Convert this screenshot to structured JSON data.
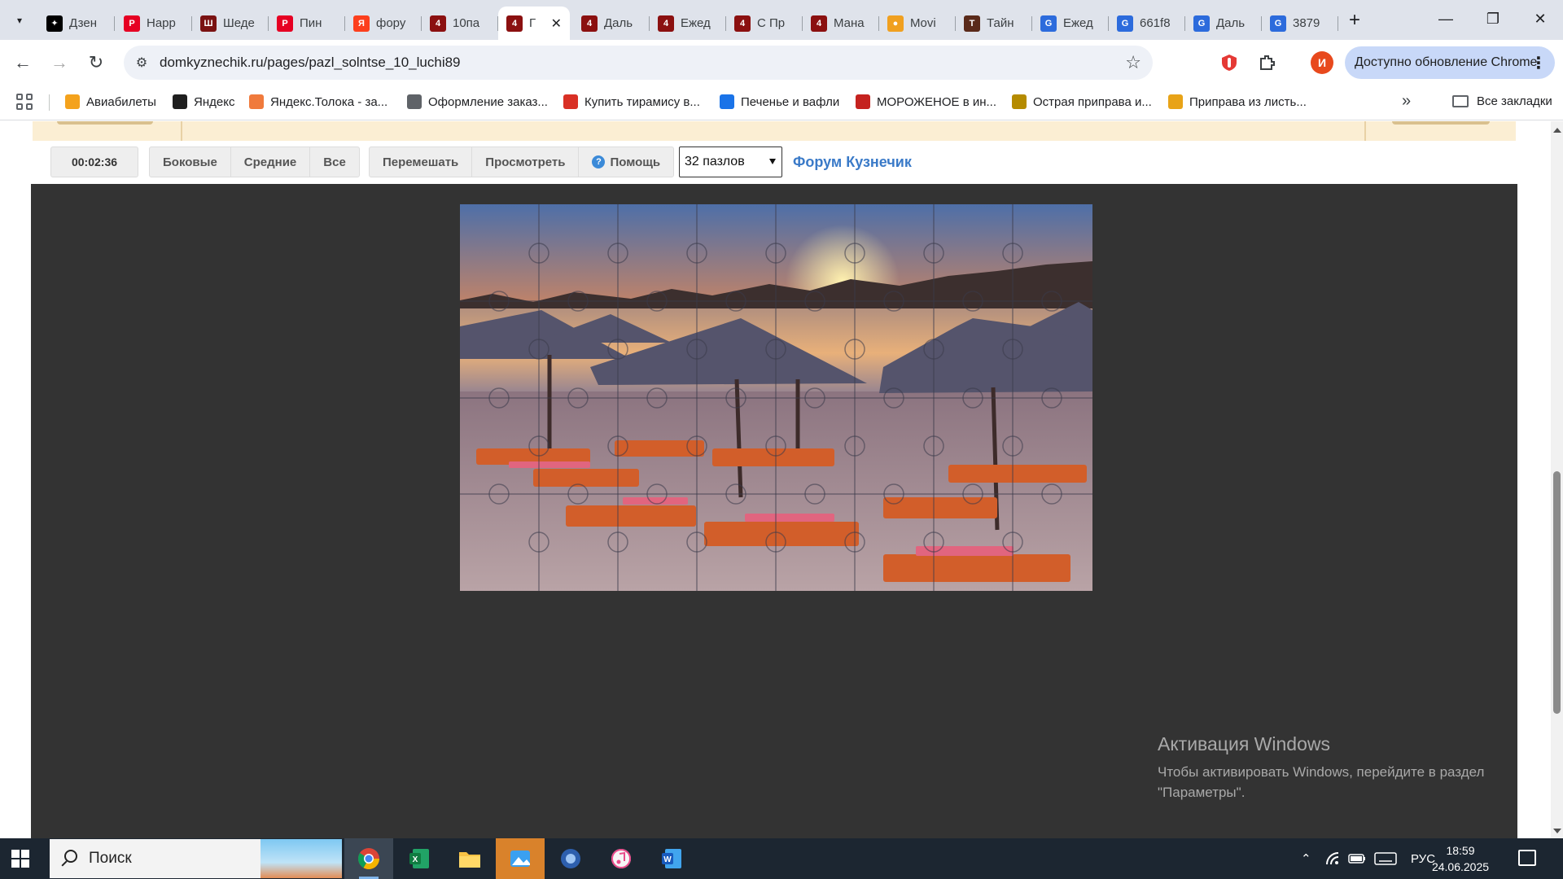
{
  "browser": {
    "tabs": [
      {
        "title": "Дзен",
        "color": "#000000",
        "glyph": "✦"
      },
      {
        "title": "Нарр",
        "color": "#e60023",
        "glyph": "P"
      },
      {
        "title": "Шеде",
        "color": "#7a1212",
        "glyph": "Ш"
      },
      {
        "title": "Пин",
        "color": "#e60023",
        "glyph": "P"
      },
      {
        "title": "фору",
        "color": "#fc3f1d",
        "glyph": "Я"
      },
      {
        "title": "10па",
        "color": "#8b1010",
        "glyph": "4"
      },
      {
        "title": "Г",
        "color": "#8b1010",
        "glyph": "4",
        "active": true
      },
      {
        "title": "Даль",
        "color": "#8b1010",
        "glyph": "4"
      },
      {
        "title": "Ежед",
        "color": "#8b1010",
        "glyph": "4"
      },
      {
        "title": "С Пр",
        "color": "#8b1010",
        "glyph": "4"
      },
      {
        "title": "Мана",
        "color": "#8b1010",
        "glyph": "4"
      },
      {
        "title": "Movi",
        "color": "#f0a020",
        "glyph": "●"
      },
      {
        "title": "Тайн",
        "color": "#5a2a1a",
        "glyph": "Т"
      },
      {
        "title": "Ежед",
        "color": "#2c6bdc",
        "glyph": "G"
      },
      {
        "title": "661f8",
        "color": "#2c6bdc",
        "glyph": "G"
      },
      {
        "title": "Даль",
        "color": "#2c6bdc",
        "glyph": "G"
      },
      {
        "title": "3879",
        "color": "#2c6bdc",
        "glyph": "G"
      }
    ],
    "url": "domkyznechik.ru/pages/pazl_solntse_10_luchi89",
    "profile_initial": "И",
    "update_label": "Доступно обновление Chrome",
    "bookmarks": [
      {
        "label": "Авиабилеты",
        "color": "#f4a21c"
      },
      {
        "label": "Яндекс",
        "color": "#1f1f1f"
      },
      {
        "label": "Яндекс.Толока - за...",
        "color": "#f07a3c"
      },
      {
        "label": "Оформление заказ...",
        "color": "#5f6368"
      },
      {
        "label": "Купить тирамису в...",
        "color": "#d93025"
      },
      {
        "label": "Печенье и вафли",
        "color": "#1a73e8"
      },
      {
        "label": "МОРОЖЕНОЕ в ин...",
        "color": "#c5221f"
      },
      {
        "label": "Острая приправа и...",
        "color": "#b58b00"
      },
      {
        "label": "Приправа из листь...",
        "color": "#e8a317"
      }
    ],
    "all_bookmarks_label": "Все закладки"
  },
  "puzzle_page": {
    "timer": "00:02:36",
    "view_buttons": [
      "Боковые",
      "Средние",
      "Все"
    ],
    "action_buttons": {
      "shuffle": "Перемешать",
      "preview": "Просмотреть",
      "help": "Помощь"
    },
    "pieces_select": "32 пазлов",
    "forum_link": "Форум Кузнечик",
    "board_color": "#333333"
  },
  "windows": {
    "activation_title": "Активация Windows",
    "activation_text": "Чтобы активировать Windows, перейдите в раздел \"Параметры\".",
    "search_placeholder": "Поиск",
    "language": "РУС",
    "time": "18:59",
    "date": "24.06.2025"
  }
}
